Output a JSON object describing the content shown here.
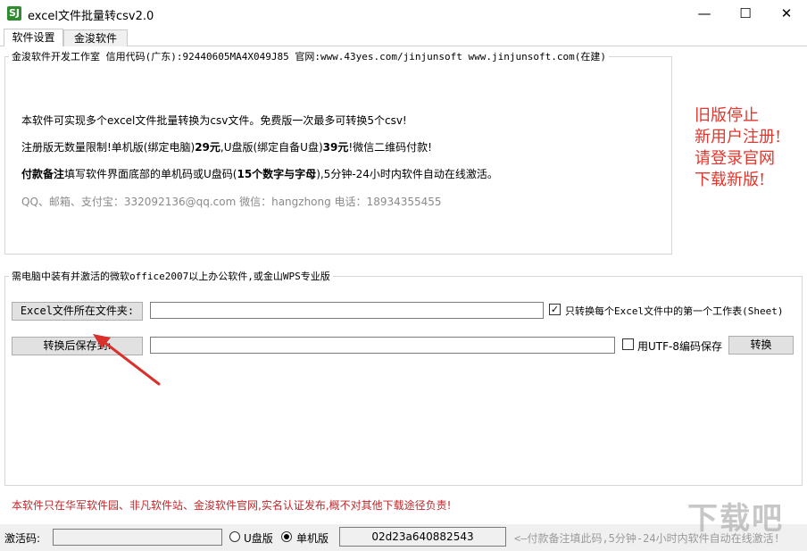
{
  "window": {
    "title": "excel文件批量转csv2.0",
    "app_icon_text": "SJ",
    "controls": {
      "minimize": "—",
      "maximize": "☐",
      "close": "✕"
    }
  },
  "tabs": [
    {
      "label": "软件设置",
      "active": true
    },
    {
      "label": "金浚软件",
      "active": false
    }
  ],
  "info_group": {
    "legend": "金浚软件开发工作室 信用代码(广东):92440605MA4X049J85 官网:www.43yes.com/jinjunsoft  www.jinjunsoft.com(在建)",
    "line1": "本软件可实现多个excel文件批量转换为csv文件。免费版一次最多可转换5个csv!",
    "line2_a": "注册版无数量限制!单机版(绑定电脑)",
    "line2_b": "29元",
    "line2_c": ",U盘版(绑定自备U盘)",
    "line2_d": "39元",
    "line2_e": "!微信二维码付款!",
    "line3_a": "付款备注",
    "line3_b": "填写软件界面底部的单机码或U盘码(",
    "line3_c": "15个数字与字母",
    "line3_d": "),5分钟-24小时内软件自动在线激活。",
    "contact": "QQ、邮箱、支付宝：332092136@qq.com   微信：hangzhong   电话：18934355455"
  },
  "notice": {
    "lines": [
      "旧版停止",
      "新用户注册!",
      "请登录官网",
      "下载新版!"
    ],
    "color": "#e3372e"
  },
  "convert_group": {
    "legend": "需电脑中装有并激活的微软office2007以上办公软件,或金山WPS专业版",
    "excel_folder_button": "Excel文件所在文件夹:",
    "excel_folder_value": "",
    "first_sheet_checked": true,
    "first_sheet_label": "只转换每个Excel文件中的第一个工作表(Sheet)",
    "save_to_button": "转换后保存到:",
    "save_to_value": "",
    "utf8_checked": false,
    "utf8_label": "用UTF-8编码保存",
    "convert_button": "转换"
  },
  "disclaimer": "本软件只在华军软件园、非凡软件站、金浚软件官网,实名认证发布,概不对其他下载途径负责!",
  "statusbar": {
    "activation_label": "激活码:",
    "activation_value": "",
    "option_udisk": "U盘版",
    "option_single": "单机版",
    "selected_option": "单机版",
    "machine_code": "02d23a640882543",
    "hint": "<—付款备注填此码,5分钟-24小时内软件自动在线激活!"
  },
  "watermark": "下载吧"
}
